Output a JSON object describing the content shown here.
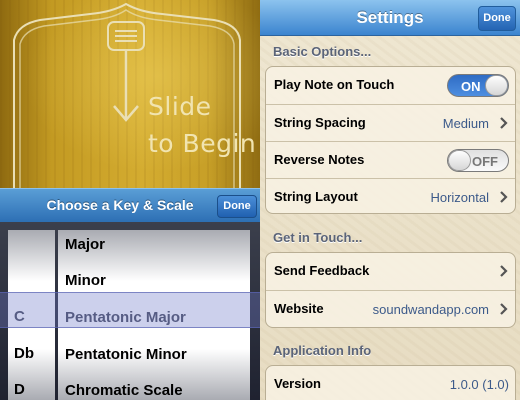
{
  "left": {
    "slide_line1": "Slide",
    "slide_line2": "to Begin",
    "picker_title": "Choose a Key & Scale",
    "done_label": "Done",
    "keys": [
      "",
      "",
      "C",
      "Db",
      "D"
    ],
    "scales": [
      "Major",
      "Minor",
      "Pentatonic Major",
      "Pentatonic Minor",
      "Chromatic Scale"
    ],
    "selected_key": "C",
    "selected_scale": "Pentatonic Major"
  },
  "settings": {
    "title": "Settings",
    "done_label": "Done",
    "basic_header": "Basic Options...",
    "play_note_label": "Play Note on Touch",
    "play_note_toggle": "ON",
    "string_spacing_label": "String Spacing",
    "string_spacing_value": "Medium",
    "reverse_notes_label": "Reverse Notes",
    "reverse_notes_toggle": "OFF",
    "string_layout_label": "String Layout",
    "string_layout_value": "Horizontal",
    "contact_header": "Get in Touch...",
    "feedback_label": "Send Feedback",
    "website_label": "Website",
    "website_value": "soundwandapp.com",
    "info_header": "Application Info",
    "version_label": "Version",
    "version_value": "1.0.0 (1.0)"
  },
  "colors": {
    "nav_blue": "#3b84cf",
    "toggle_on": "#2f6cc4",
    "value_blue": "#3c5a8a",
    "wood_gold": "#c39a22"
  },
  "icons": {
    "chevron": "chevron-right-icon",
    "wand": "wand-arrow-icon"
  }
}
